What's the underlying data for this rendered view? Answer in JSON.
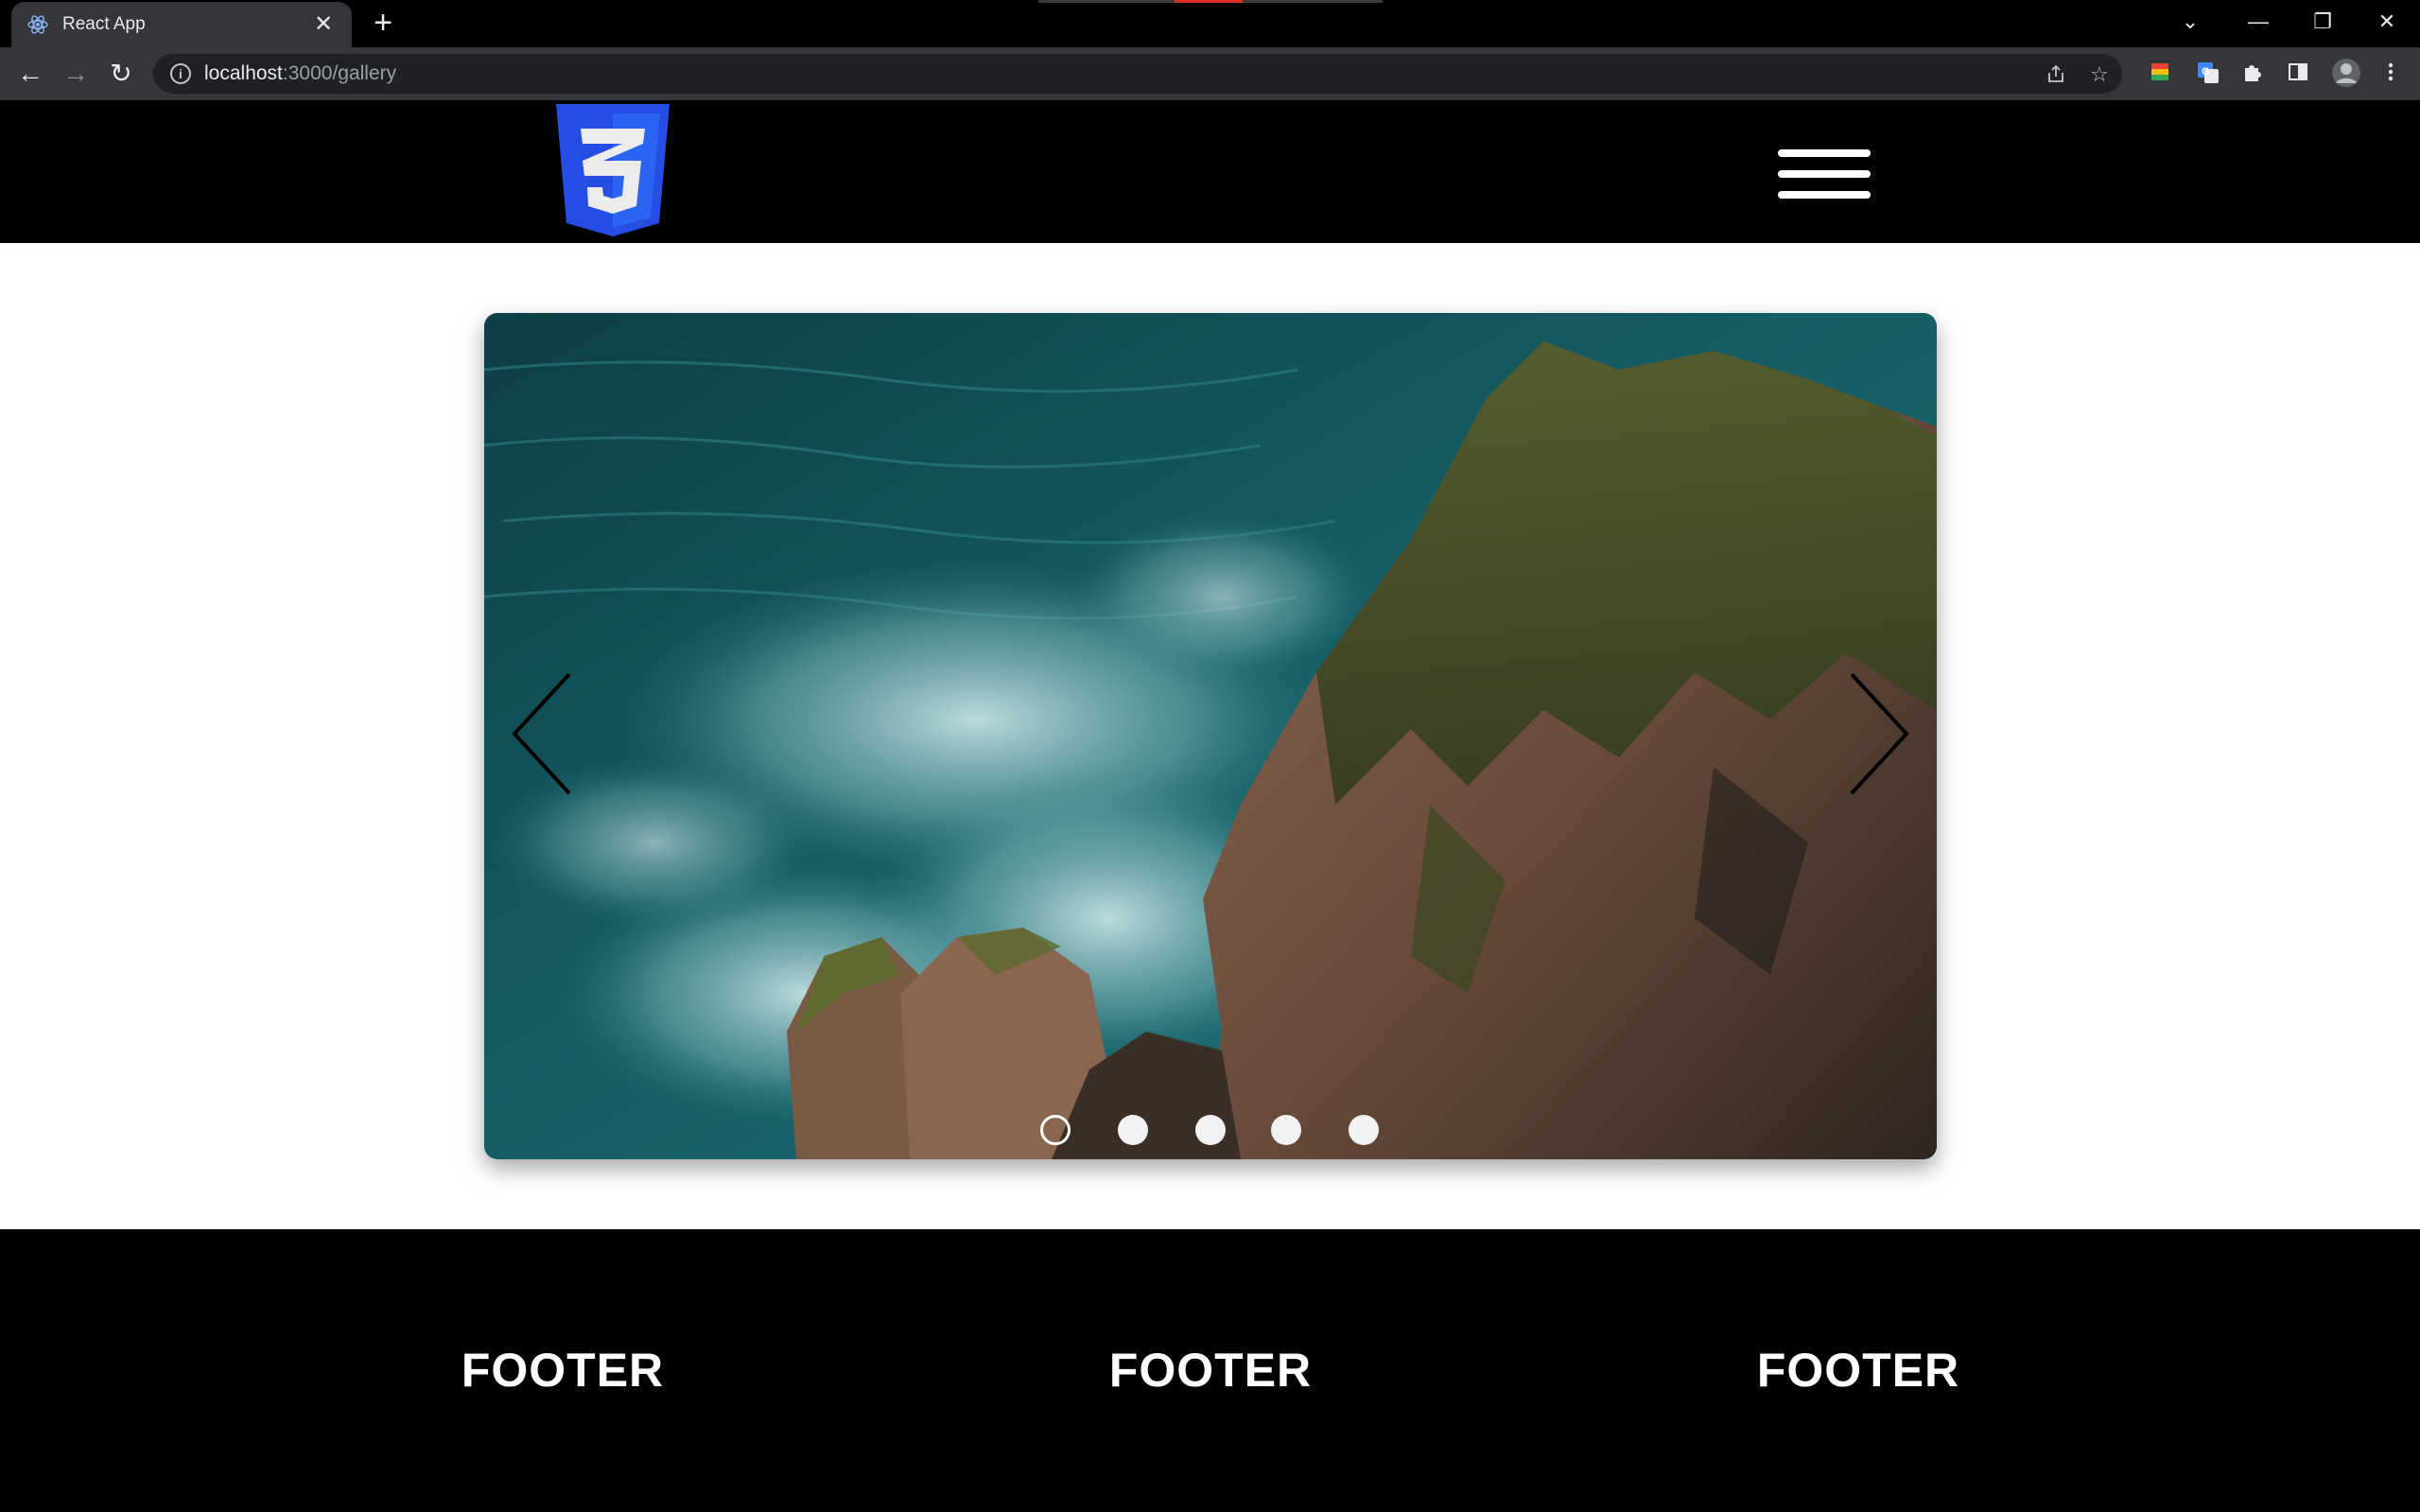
{
  "browser": {
    "tab_title": "React App",
    "tab_close": "✕",
    "new_tab": "+",
    "url_host": "localhost",
    "url_rest": ":3000/gallery",
    "nav": {
      "back": "←",
      "forward": "→",
      "reload": "↻"
    },
    "window_controls": {
      "tab_search": "⌄",
      "minimize": "—",
      "restore": "❐",
      "close": "✕"
    },
    "icons": [
      "share-icon",
      "bookmark-star-icon",
      "extension-color-icon",
      "translate-icon",
      "extensions-puzzle-icon",
      "side-panel-icon",
      "profile-avatar-icon",
      "menu-kebab-icon"
    ]
  },
  "header": {
    "logo": "css3-logo",
    "logo_number": "3",
    "menu_icon": "hamburger-menu-icon",
    "brand_color": "#264de4"
  },
  "gallery": {
    "slide_description_icon": "ocean-cliff-photo",
    "prev_icon": "chevron-left-icon",
    "next_icon": "chevron-right-icon",
    "slide_count": 5,
    "active_index": 0
  },
  "footer": {
    "columns": [
      "FOOTER",
      "FOOTER",
      "FOOTER"
    ]
  }
}
